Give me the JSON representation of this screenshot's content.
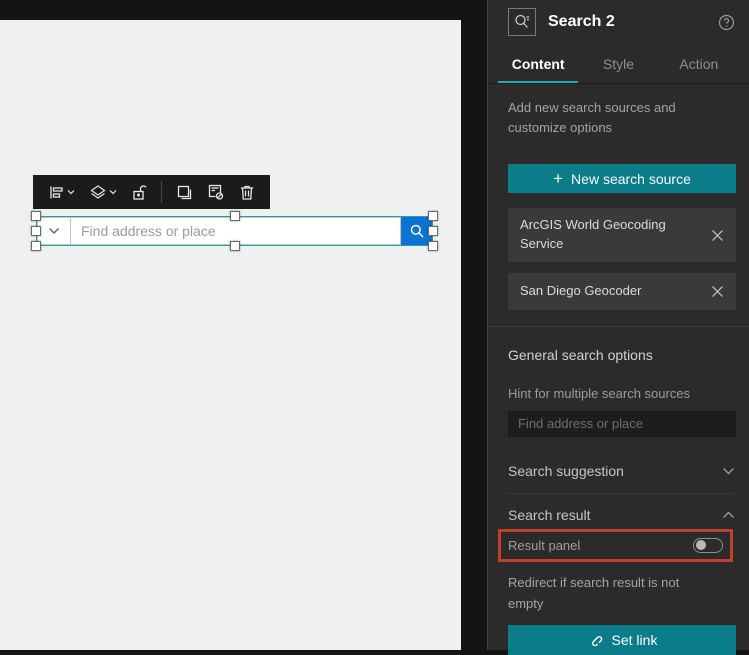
{
  "canvas": {
    "toolbar": {
      "icons": [
        {
          "name": "align-icon",
          "has_dropdown": true
        },
        {
          "name": "order-icon",
          "has_dropdown": true
        },
        {
          "name": "unlock-icon",
          "has_dropdown": false
        },
        {
          "name": "duplicate-icon",
          "has_dropdown": false
        },
        {
          "name": "pending-icon",
          "has_dropdown": false
        },
        {
          "name": "delete-icon",
          "has_dropdown": false
        }
      ]
    },
    "search_widget": {
      "placeholder": "Find address or place",
      "value": "",
      "source_dropdown_icon": "chevron-down-icon",
      "search_button_icon": "magnifier-icon",
      "search_button_color": "#0e72d3",
      "selection_color": "#22a0b2"
    }
  },
  "panel": {
    "header": {
      "title": "Search 2",
      "widget_icon": "search-suggest-icon",
      "help_icon": "help-circle-icon"
    },
    "tabs": [
      {
        "label": "Content",
        "active": true
      },
      {
        "label": "Style",
        "active": false
      },
      {
        "label": "Action",
        "active": false
      }
    ],
    "description": "Add new search sources and customize options",
    "new_source_button": {
      "label": "New search source",
      "icon": "plus-icon"
    },
    "sources": [
      {
        "name": "ArcGIS World Geocoding Service",
        "remove_icon": "close-icon"
      },
      {
        "name": "San Diego Geocoder",
        "remove_icon": "close-icon"
      }
    ],
    "general_options_heading": "General search options",
    "hint": {
      "label": "Hint for multiple search sources",
      "placeholder": "Find address or place",
      "value": ""
    },
    "sections": {
      "suggestion": {
        "label": "Search suggestion",
        "expanded": false,
        "icon": "chevron-down-icon"
      },
      "result": {
        "label": "Search result",
        "expanded": true,
        "icon": "chevron-up-icon"
      }
    },
    "result_panel": {
      "label": "Result panel",
      "toggle_state": "off"
    },
    "redirect_text": "Redirect if search result is not empty",
    "set_link_button": {
      "label": "Set link",
      "icon": "link-icon"
    },
    "annotation": {
      "type": "highlight-rectangle",
      "color": "#c0402e"
    }
  },
  "colors": {
    "panel_bg": "#2b2b2b",
    "page_bg": "#141414",
    "canvas_bg": "#f0f0f0",
    "accent_teal": "#0b7c8a",
    "tab_underline": "#24a6b6",
    "search_button_blue": "#0e72d3",
    "highlight_red": "#c0402e",
    "source_item_bg": "#3a3a3a"
  }
}
